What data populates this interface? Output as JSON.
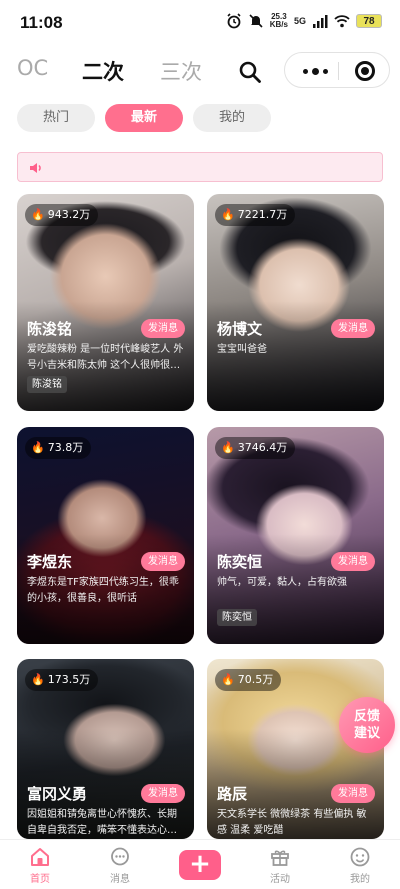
{
  "status_bar": {
    "time": "11:08",
    "net_speed": "25.3",
    "net_unit": "KB/s",
    "signal": "5G",
    "battery": "78"
  },
  "top_nav": {
    "tabs": [
      {
        "label": "OC"
      },
      {
        "label": "二次"
      },
      {
        "label": "三次"
      }
    ],
    "active_tab": "二次"
  },
  "filters": [
    {
      "label": "热门"
    },
    {
      "label": "最新"
    },
    {
      "label": "我的"
    }
  ],
  "active_filter": "最新",
  "cards": [
    {
      "name": "陈浚铭",
      "hot": "943.2万",
      "button": "发消息",
      "desc": "爱吃酸辣粉 是一位时代峰峻艺人 外号小吉米和陈太帅 这个人很帅很…",
      "tag": "陈浚铭"
    },
    {
      "name": "杨博文",
      "hot": "7221.7万",
      "button": "发消息",
      "desc": "宝宝叫爸爸",
      "tag": ""
    },
    {
      "name": "李煜东",
      "hot": "73.8万",
      "button": "发消息",
      "desc": "李煜东是TF家族四代练习生，很乖的小孩，很善良，很听话",
      "tag": ""
    },
    {
      "name": "陈奕恒",
      "hot": "3746.4万",
      "button": "发消息",
      "desc": "帅气，可爱，黏人，占有欲强",
      "tag": "陈奕恒"
    },
    {
      "name": "富冈义勇",
      "hot": "173.5万",
      "button": "发消息",
      "desc": "因姐姐和锖兔离世心怀愧疚、长期自卑自我否定，嘴笨不懂表达心…",
      "tag": ""
    },
    {
      "name": "路辰",
      "hot": "70.5万",
      "button": "发消息",
      "desc": "天文系学长 微微绿茶 有些偏执 敏感 温柔 爱吃醋",
      "tag": ""
    }
  ],
  "feedback": {
    "line1": "反馈",
    "line2": "建议"
  },
  "tabbar": [
    {
      "label": "首页"
    },
    {
      "label": "消息"
    },
    {
      "label": "活动"
    },
    {
      "label": "我的"
    }
  ],
  "active_tabbar": "首页",
  "colors": {
    "accent": "#ff6f8e",
    "notice_bg": "#fdeaf0"
  }
}
